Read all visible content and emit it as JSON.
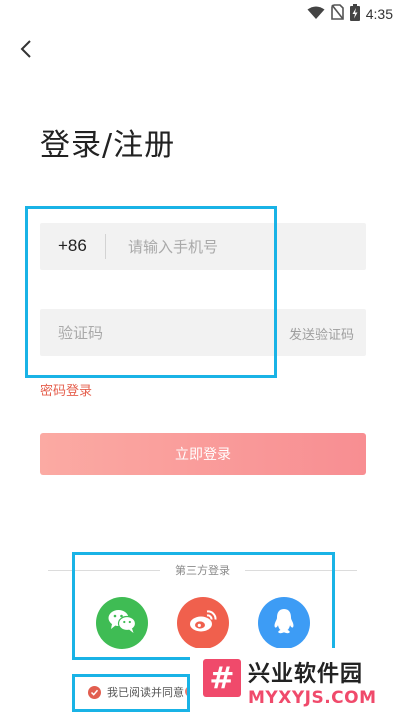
{
  "status_bar": {
    "time": "4:35",
    "icons": [
      "wifi-icon",
      "no-sim-icon",
      "battery-charging-icon"
    ]
  },
  "header": {
    "back_icon": "chevron-left-icon",
    "title": "登录/注册"
  },
  "form": {
    "country_code": "+86",
    "phone_placeholder": "请输入手机号",
    "phone_value": "",
    "code_placeholder": "验证码",
    "code_value": "",
    "send_code_label": "发送验证码",
    "password_login_label": "密码登录",
    "login_button_label": "立即登录"
  },
  "third_party": {
    "label": "第三方登录",
    "providers": [
      {
        "name": "wechat",
        "icon": "wechat-icon",
        "color": "#3fbc54"
      },
      {
        "name": "weibo",
        "icon": "weibo-icon",
        "color": "#f0604d"
      },
      {
        "name": "qq",
        "icon": "qq-icon",
        "color": "#3d9cf5"
      }
    ]
  },
  "agreement": {
    "text": "我已阅读并同意",
    "checked": true
  },
  "watermark": {
    "logo_glyph": "#",
    "title": "兴业软件园",
    "subtitle": "MYXYJS.COM"
  },
  "colors": {
    "accent": "#e55f4d",
    "button_start": "#fbaaa3",
    "button_end": "#f88e92",
    "highlight_box": "#19b3e6",
    "watermark_brand": "#f04a6b"
  }
}
